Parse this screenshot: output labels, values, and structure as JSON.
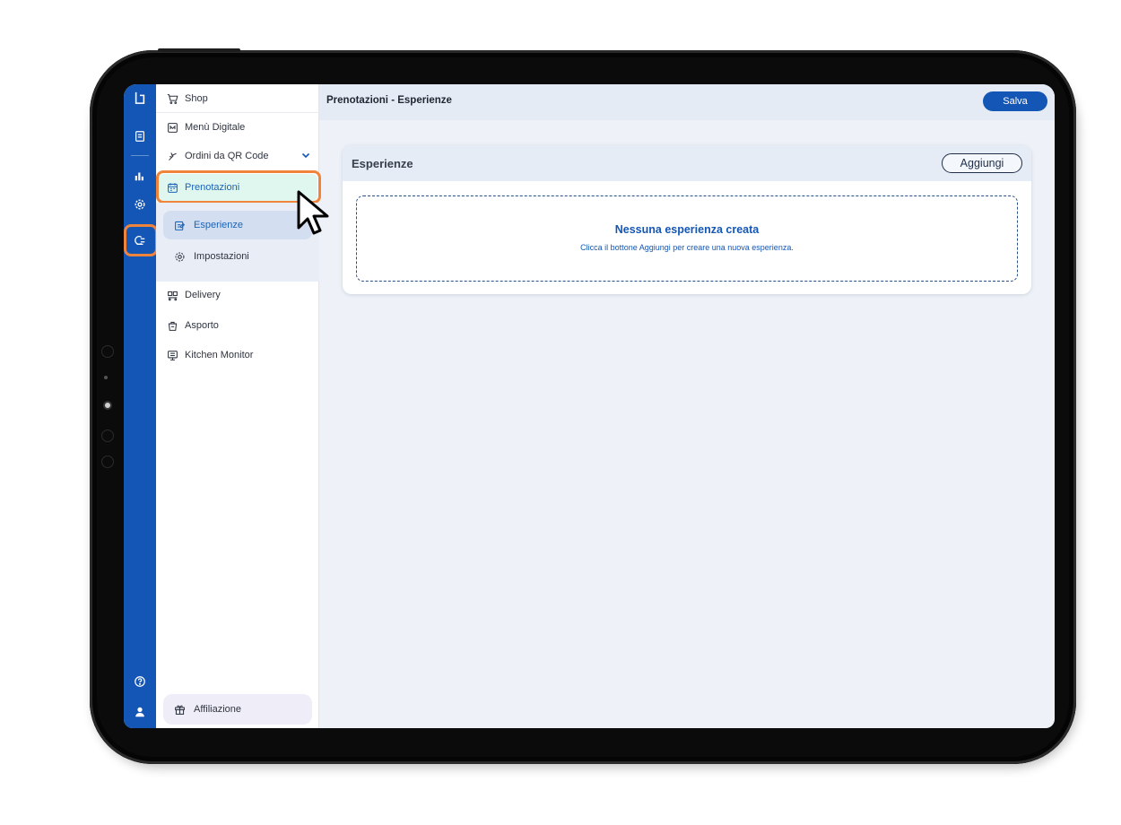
{
  "app": {
    "title": "Prenotazioni - Esperienze",
    "accent_color": "#1456b5",
    "highlight_color": "#f0843a"
  },
  "rail": {
    "items": [
      {
        "icon": "logo-icon"
      },
      {
        "icon": "receipt-icon"
      },
      {
        "icon": "chart-icon"
      },
      {
        "icon": "settings-icon"
      },
      {
        "icon": "plug-icon"
      },
      {
        "icon": "help-icon"
      },
      {
        "icon": "user-icon"
      }
    ]
  },
  "sidebar": {
    "items": [
      {
        "label": "Shop",
        "icon": "cart-icon"
      },
      {
        "label": "Menù Digitale",
        "icon": "menu-book-icon"
      },
      {
        "label": "Ordini da QR Code",
        "icon": "qr-order-icon"
      },
      {
        "label": "Prenotazioni",
        "icon": "calendar-icon"
      },
      {
        "label": "Delivery",
        "icon": "delivery-icon"
      },
      {
        "label": "Asporto",
        "icon": "takeaway-icon"
      },
      {
        "label": "Kitchen Monitor",
        "icon": "monitor-icon"
      }
    ],
    "subitems": [
      {
        "label": "Esperienze",
        "icon": "edit-icon"
      },
      {
        "label": "Impostazioni",
        "icon": "gear-icon"
      }
    ],
    "affiliation": {
      "label": "Affiliazione",
      "icon": "gift-icon"
    }
  },
  "header": {
    "title": "Prenotazioni - Esperienze",
    "save_label": "Salva"
  },
  "card": {
    "title": "Esperienze",
    "add_label": "Aggiungi",
    "empty_title": "Nessuna esperienza creata",
    "empty_text": "Clicca il bottone Aggiungi per creare una nuova esperienza."
  }
}
